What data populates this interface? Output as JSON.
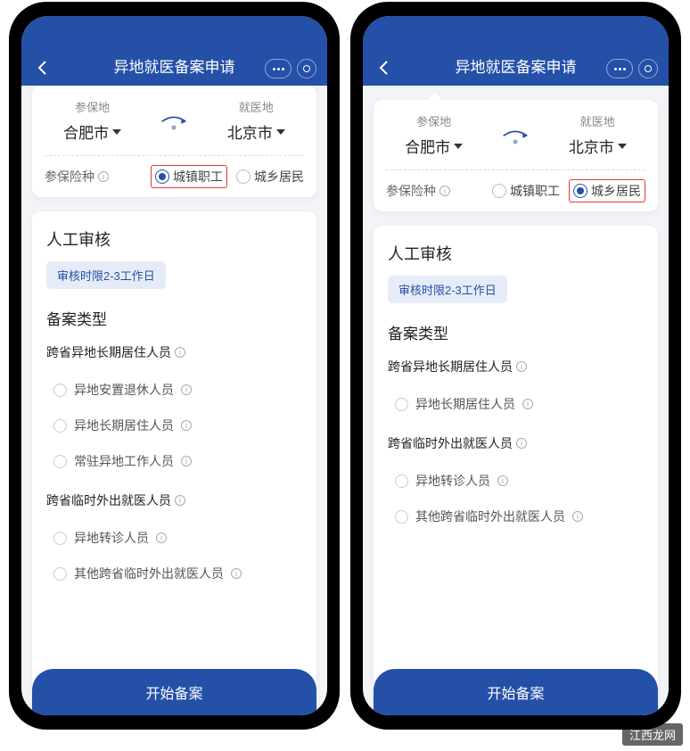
{
  "left": {
    "title": "异地就医备案申请",
    "insured_loc_label": "参保地",
    "insured_loc": "合肥市",
    "treat_loc_label": "就医地",
    "treat_loc": "北京市",
    "insure_type_label": "参保险种",
    "radio1": "城镇职工",
    "radio2": "城乡居民",
    "review_title": "人工审核",
    "review_badge": "审核时限2-3工作日",
    "type_title": "备案类型",
    "group1": "跨省异地长期居住人员",
    "g1_opts": [
      "异地安置退休人员",
      "异地长期居住人员",
      "常驻异地工作人员"
    ],
    "group2": "跨省临时外出就医人员",
    "g2_opts": [
      "异地转诊人员",
      "其他跨省临时外出就医人员"
    ],
    "submit": "开始备案"
  },
  "right": {
    "title": "异地就医备案申请",
    "insured_loc_label": "参保地",
    "insured_loc": "合肥市",
    "treat_loc_label": "就医地",
    "treat_loc": "北京市",
    "insure_type_label": "参保险种",
    "radio1": "城镇职工",
    "radio2": "城乡居民",
    "review_title": "人工审核",
    "review_badge": "审核时限2-3工作日",
    "type_title": "备案类型",
    "group1": "跨省异地长期居住人员",
    "g1_opts": [
      "异地长期居住人员"
    ],
    "group2": "跨省临时外出就医人员",
    "g2_opts": [
      "异地转诊人员",
      "其他跨省临时外出就医人员"
    ],
    "submit": "开始备案"
  },
  "watermark": "江西龙网"
}
